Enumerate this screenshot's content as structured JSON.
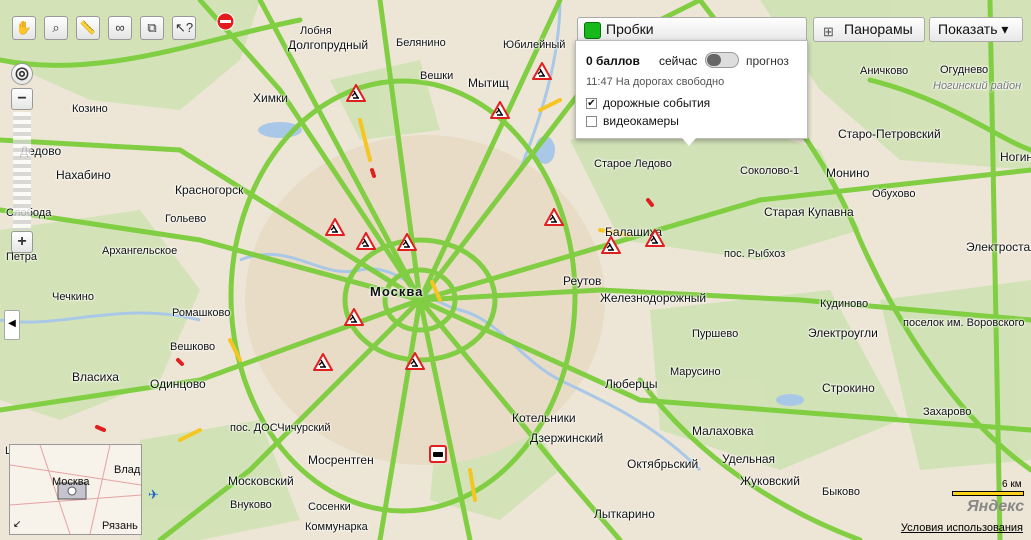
{
  "toolbar": {
    "tools": [
      {
        "name": "hand-tool-button",
        "glyph": "✋"
      },
      {
        "name": "magnifier-tool-button",
        "glyph": "⌕"
      },
      {
        "name": "ruler-tool-button",
        "glyph": "📏"
      },
      {
        "name": "route-tool-button",
        "glyph": "∞"
      },
      {
        "name": "bookmark-tool-button",
        "glyph": "⧉"
      },
      {
        "name": "cursor-help-tool-button",
        "glyph": "↖?"
      }
    ]
  },
  "zoom": {
    "in_label": "+",
    "out_label": "−"
  },
  "buttons": {
    "traffic_label": "Пробки",
    "panoramas_label": "Панорамы",
    "show_label": "Показать ▾"
  },
  "traffic_panel": {
    "score": "0 баллов",
    "now": "сейчас",
    "forecast": "прогноз",
    "status": "11:47 На дорогах свободно",
    "option_events": "дорожные события",
    "option_cameras": "видеокамеры",
    "events_checked": true,
    "cameras_checked": false
  },
  "map_labels": [
    {
      "text": "Долгопрудный",
      "cls": ""
    },
    {
      "text": "Белянино",
      "cls": "small"
    },
    {
      "text": "Юбилейный",
      "cls": "small"
    },
    {
      "text": "Химки",
      "cls": ""
    },
    {
      "text": "Вешки",
      "cls": "small"
    },
    {
      "text": "Мытищ",
      "cls": ""
    },
    {
      "text": "Козино",
      "cls": "small"
    },
    {
      "text": "Дедово",
      "cls": ""
    },
    {
      "text": "Нахабино",
      "cls": ""
    },
    {
      "text": "Красногорск",
      "cls": ""
    },
    {
      "text": "Гольево",
      "cls": "small"
    },
    {
      "text": "Слобода",
      "cls": "small"
    },
    {
      "text": "Архангельское",
      "cls": "small"
    },
    {
      "text": "Петра",
      "cls": "small"
    },
    {
      "text": "Чечкино",
      "cls": "small"
    },
    {
      "text": "Ромашково",
      "cls": "small"
    },
    {
      "text": "Вешково",
      "cls": "small"
    },
    {
      "text": "Власиха",
      "cls": ""
    },
    {
      "text": "Одинцово",
      "cls": ""
    },
    {
      "text": "Москва",
      "cls": "city"
    },
    {
      "text": "Реутов",
      "cls": ""
    },
    {
      "text": "Балашиха",
      "cls": ""
    },
    {
      "text": "Железнодорожный",
      "cls": ""
    },
    {
      "text": "Пуршево",
      "cls": "small"
    },
    {
      "text": "Марусино",
      "cls": "small"
    },
    {
      "text": "Люберцы",
      "cls": ""
    },
    {
      "text": "Котельники",
      "cls": ""
    },
    {
      "text": "Дзержинский",
      "cls": ""
    },
    {
      "text": "Малаховка",
      "cls": ""
    },
    {
      "text": "Октябрьский",
      "cls": ""
    },
    {
      "text": "Удельная",
      "cls": ""
    },
    {
      "text": "Жуковский",
      "cls": ""
    },
    {
      "text": "Лыткарино",
      "cls": ""
    },
    {
      "text": "Быково",
      "cls": "small"
    },
    {
      "text": "Московский",
      "cls": ""
    },
    {
      "text": "Мосрентген",
      "cls": ""
    },
    {
      "text": "Сосенки",
      "cls": "small"
    },
    {
      "text": "Коммунарка",
      "cls": "small"
    },
    {
      "text": "Внуково",
      "cls": "small"
    },
    {
      "text": "Монино",
      "cls": ""
    },
    {
      "text": "Старая Купавна",
      "cls": ""
    },
    {
      "text": "Электроугли",
      "cls": ""
    },
    {
      "text": "Электросталь",
      "cls": ""
    },
    {
      "text": "Ногинск",
      "cls": ""
    },
    {
      "text": "Аничково",
      "cls": "small"
    },
    {
      "text": "Соколово-1",
      "cls": "small"
    },
    {
      "text": "Старое Ледово",
      "cls": "small"
    },
    {
      "text": "Обухово",
      "cls": "small"
    },
    {
      "text": "пос. Рыбхоз",
      "cls": "small"
    },
    {
      "text": "Кудиново",
      "cls": "small"
    },
    {
      "text": "поселок им. Воровского",
      "cls": "small"
    },
    {
      "text": "Захарово",
      "cls": "small"
    },
    {
      "text": "Строкино",
      "cls": ""
    },
    {
      "text": "Старо-Петровский",
      "cls": ""
    },
    {
      "text": "Ногинский район",
      "cls": "faint"
    },
    {
      "text": "Огуднево",
      "cls": "small"
    },
    {
      "text": "пос. ДОСЧичурский",
      "cls": "small"
    },
    {
      "text": "Щербинка",
      "cls": "small"
    },
    {
      "text": "Лобня",
      "cls": "small"
    }
  ],
  "minimap": {
    "city": "Москва",
    "n1": "Влад",
    "n2": "Рязань"
  },
  "scale_label": "6 км",
  "logo": "Яндекс",
  "terms_label": "Условия использования",
  "colors": {
    "road_free": "#7ccd3c",
    "road_slow": "#f5c623",
    "road_jam": "#e02020",
    "water": "#a9c8e8",
    "forest": "#c9dfae"
  }
}
